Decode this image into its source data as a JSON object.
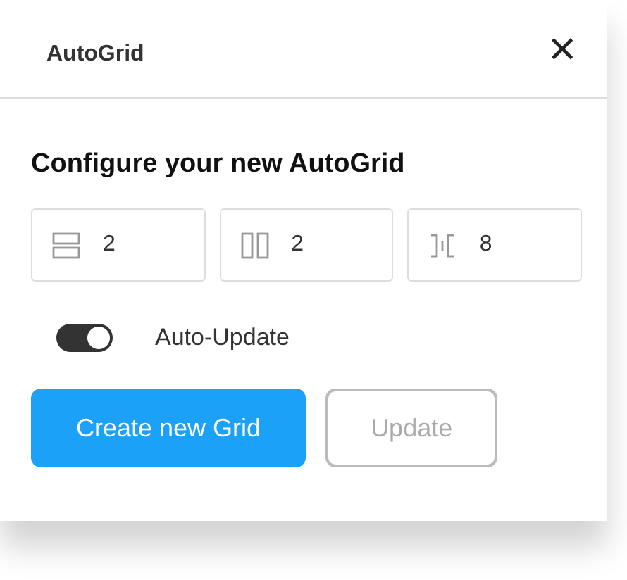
{
  "window": {
    "title": "AutoGrid",
    "close": "×"
  },
  "heading": "Configure your new AutoGrid",
  "fields": [
    {
      "kind": "rows",
      "value": "2"
    },
    {
      "kind": "columns",
      "value": "2"
    },
    {
      "kind": "gutter",
      "value": "8"
    }
  ],
  "toggle": {
    "label": "Auto-Update",
    "on": true
  },
  "buttons": [
    {
      "label": "Create new Grid",
      "kind": "primary",
      "disabled": false
    },
    {
      "label": "Update",
      "kind": "secondary",
      "disabled": true
    }
  ]
}
